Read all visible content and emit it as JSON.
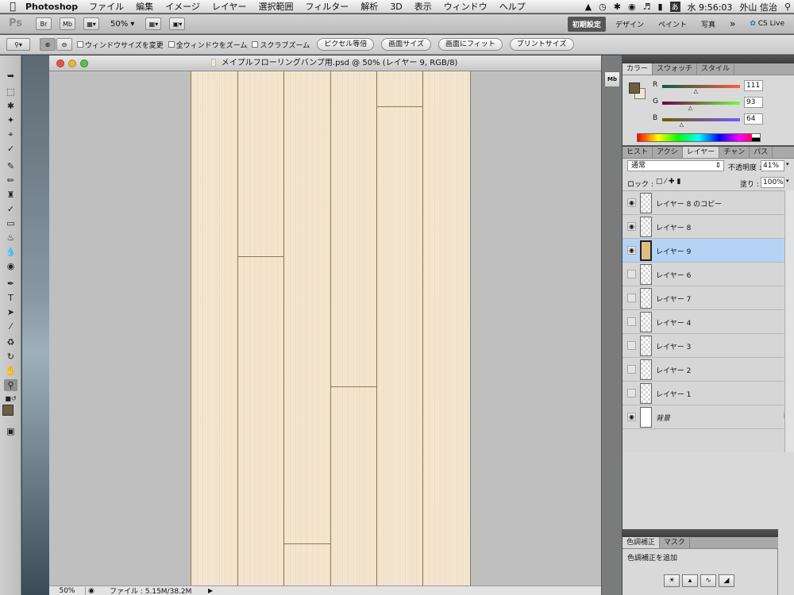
{
  "menubar": {
    "app_name": "Photoshop",
    "items": [
      "ファイル",
      "編集",
      "イメージ",
      "レイヤー",
      "選択範囲",
      "フィルター",
      "解析",
      "3D",
      "表示",
      "ウィンドウ",
      "ヘルプ"
    ],
    "clock": "水 9:56:03",
    "user": "外山 信治"
  },
  "appbar": {
    "logo": "Ps",
    "br_label": "Br",
    "mb_label": "Mb",
    "zoom": "50%",
    "workspaces": [
      "初期設定",
      "デザイン",
      "ペイント",
      "写真"
    ],
    "more": "»",
    "cs_live": "CS Live"
  },
  "options": {
    "resize_windows": "ウィンドウサイズを変更",
    "zoom_all": "全ウィンドウをズーム",
    "scrubby_zoom": "スクラブズーム",
    "actual_pixels": "ピクセル等倍",
    "fit_screen": "画面サイズ",
    "fill_screen": "画面にフィット",
    "print_size": "プリントサイズ"
  },
  "document": {
    "title": "メイプルフローリングバンプ用.psd @ 50% (レイヤー 9, RGB/8)",
    "zoom": "50%",
    "file_info": "ファイル : 5.15M/38.2M"
  },
  "color_panel": {
    "tabs": [
      "カラー",
      "スウォッチ",
      "スタイル"
    ],
    "r_label": "R",
    "r": "111",
    "r_fraction": 0.435,
    "g_label": "G",
    "g": "93",
    "g_fraction": 0.365,
    "b_label": "B",
    "b": "64",
    "b_fraction": 0.251,
    "fg_color": "#6f5d40"
  },
  "layers_panel": {
    "tabs": [
      "ヒスト",
      "アクシ",
      "レイヤー",
      "チャン",
      "パス"
    ],
    "blend_mode": "通常",
    "opacity_label": "不透明度 :",
    "opacity": "41%",
    "lock_label": "ロック :",
    "fill_label": "塗り :",
    "fill": "100%",
    "layers": [
      {
        "name": "レイヤー 8 のコピー",
        "visible": true
      },
      {
        "name": "レイヤー 8",
        "visible": true
      },
      {
        "name": "レイヤー 9",
        "visible": true,
        "selected": true
      },
      {
        "name": "レイヤー 6",
        "visible": false
      },
      {
        "name": "レイヤー 7",
        "visible": false
      },
      {
        "name": "レイヤー 4",
        "visible": false
      },
      {
        "name": "レイヤー 3",
        "visible": false
      },
      {
        "name": "レイヤー 2",
        "visible": false
      },
      {
        "name": "レイヤー 1",
        "visible": false
      },
      {
        "name": "背景",
        "visible": true,
        "locked": true
      }
    ]
  },
  "adjust_panel": {
    "tabs": [
      "色調補正",
      "マスク"
    ],
    "add_label": "色調補正を追加"
  }
}
